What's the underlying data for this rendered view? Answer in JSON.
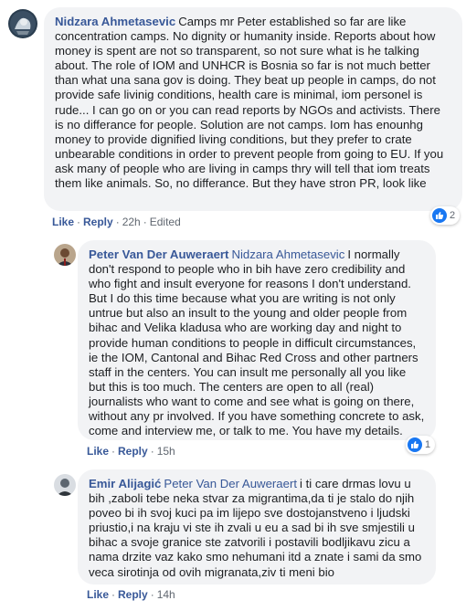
{
  "comments": [
    {
      "author": "Nidzara Ahmetasevic",
      "mention": "",
      "text": "Camps mr Peter established so far are like concentration camps. No dignity or humanity inside. Reports about how money is spent are not so transparent, so not sure what is he talking about. The role of IOM and UNHCR is Bosnia so far is not much better than what una sana gov is doing. They beat up people in camps, do not provide safe livinig conditions, health care is minimal, iom personel is rude... I can go on or you can read reports by NGOs and activists. There is no differance for people. Solution are not camps. Iom has enounhg money to provide dignified living conditions, but they prefer to crate unbearable conditions in order to prevent people from going to EU. If you ask many of people who are living in camps thry will tell that iom treats them like animals. So, no differance. But they have stron PR, look like",
      "like_label": "Like",
      "reply_label": "Reply",
      "time": "22h",
      "edited": "Edited",
      "reaction_count": "2"
    },
    {
      "author": "Peter Van Der Auweraert",
      "mention": "Nidzara Ahmetasevic",
      "text": "I normally don't respond to people who in bih have zero credibility and who fight and insult everyone for reasons I don't understand. But I do this time because what you are writing is not only untrue but also an insult to the young and older people from bihac and Velika kladusa who are working day and night to provide human conditions to people in difficult circumstances, ie the IOM, Cantonal and Bihac Red Cross and other partners staff in the centers. You can insult me personally all you like but this is too much. The centers are open to all (real) journalists who want to come and see what is going on there, without any pr involved. If you have something concrete to ask, come and interview me, or talk to me. You have my details.",
      "like_label": "Like",
      "reply_label": "Reply",
      "time": "15h",
      "reaction_count": "1"
    },
    {
      "author": "Emir Alijagić",
      "mention": "Peter Van Der Auweraert",
      "text": "i ti care drmas lovu u bih ,zaboli tebe neka stvar za migrantima,da ti je stalo do njih poveo bi ih svoj kuci pa im lijepo sve dostojanstveno i ljudski priustio,i na kraju vi ste ih zvali u eu a sad bi ih sve smjestili u bihac a svoje granice ste zatvorili i postavili bodljikavu zicu a nama drzite vaz kako smo nehumani itd a znate i sami da smo veca sirotinja od ovih migranata,ziv ti meni bio",
      "like_label": "Like",
      "reply_label": "Reply",
      "time": "14h"
    }
  ],
  "colors": {
    "bubble": "#f2f3f5",
    "name": "#385898",
    "like_blue": "#1877f2"
  }
}
